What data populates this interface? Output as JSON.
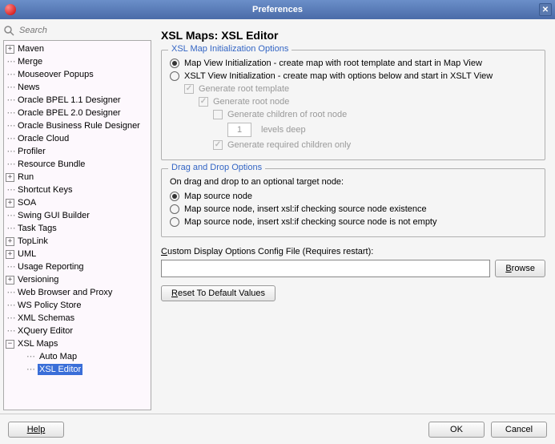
{
  "window": {
    "title": "Preferences"
  },
  "search": {
    "placeholder": "Search"
  },
  "tree": {
    "items": [
      {
        "label": "Maven",
        "expandable": true,
        "expanded": false
      },
      {
        "label": "Merge",
        "expandable": false
      },
      {
        "label": "Mouseover Popups",
        "expandable": false
      },
      {
        "label": "News",
        "expandable": false
      },
      {
        "label": "Oracle BPEL 1.1 Designer",
        "expandable": false
      },
      {
        "label": "Oracle BPEL 2.0 Designer",
        "expandable": false
      },
      {
        "label": "Oracle Business Rule Designer",
        "expandable": false
      },
      {
        "label": "Oracle Cloud",
        "expandable": false
      },
      {
        "label": "Profiler",
        "expandable": false
      },
      {
        "label": "Resource Bundle",
        "expandable": false
      },
      {
        "label": "Run",
        "expandable": true,
        "expanded": false
      },
      {
        "label": "Shortcut Keys",
        "expandable": false
      },
      {
        "label": "SOA",
        "expandable": true,
        "expanded": false
      },
      {
        "label": "Swing GUI Builder",
        "expandable": false
      },
      {
        "label": "Task Tags",
        "expandable": false
      },
      {
        "label": "TopLink",
        "expandable": true,
        "expanded": false
      },
      {
        "label": "UML",
        "expandable": true,
        "expanded": false
      },
      {
        "label": "Usage Reporting",
        "expandable": false
      },
      {
        "label": "Versioning",
        "expandable": true,
        "expanded": false
      },
      {
        "label": "Web Browser and Proxy",
        "expandable": false
      },
      {
        "label": "WS Policy Store",
        "expandable": false
      },
      {
        "label": "XML Schemas",
        "expandable": false
      },
      {
        "label": "XQuery Editor",
        "expandable": false
      },
      {
        "label": "XSL Maps",
        "expandable": true,
        "expanded": true,
        "children": [
          {
            "label": "Auto Map"
          },
          {
            "label": "XSL Editor",
            "selected": true
          }
        ]
      }
    ]
  },
  "main": {
    "title": "XSL Maps: XSL Editor",
    "init": {
      "legend": "XSL Map Initialization Options",
      "radio_map": "Map View Initialization - create map with root template and start in Map View",
      "radio_xslt": "XSLT View Initialization - create map with options below and start in XSLT View",
      "gen_root_template": "Generate root template",
      "gen_root_node": "Generate root node",
      "gen_children": "Generate children of root node",
      "levels_value": "1",
      "levels_label": "levels deep",
      "gen_required": "Generate required children only"
    },
    "drag": {
      "legend": "Drag and Drop Options",
      "intro": "On drag and drop to an optional target node:",
      "opt1": "Map source node",
      "opt2": "Map source node, insert xsl:if checking source node existence",
      "opt3": "Map source node, insert xsl:if checking source node is not empty"
    },
    "custom": {
      "label_pre": "C",
      "label_rest": "ustom Display Options Config File (Requires restart):",
      "value": "",
      "browse_u": "B",
      "browse_rest": "rowse"
    },
    "reset": {
      "u": "R",
      "rest": "eset To Default Values"
    }
  },
  "footer": {
    "help": "Help",
    "ok": "OK",
    "cancel": "Cancel"
  }
}
